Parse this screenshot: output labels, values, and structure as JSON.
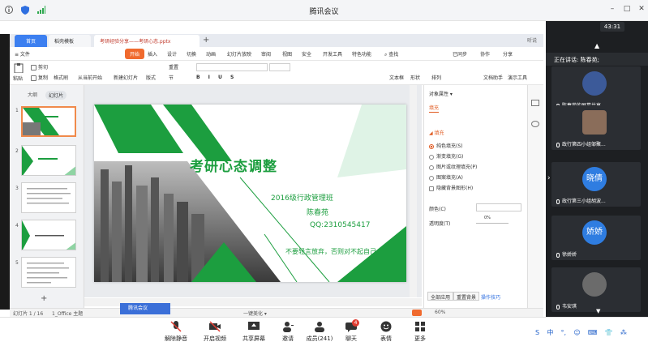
{
  "meeting": {
    "title": "腾讯会议",
    "timer": "43:31",
    "speaking_label": "正在讲话: 陈春苑;",
    "meeting_label": "腾讯会议",
    "window_buttons": [
      "–",
      "□",
      "✕"
    ]
  },
  "wps": {
    "tabs": [
      {
        "label": "首页"
      },
      {
        "label": "稻壳模板"
      },
      {
        "label": "考研经验分享——考研心态.pptx"
      }
    ],
    "tab_add": "+",
    "tab_right": "听说",
    "menu": {
      "file": "≡ 文件",
      "start": "开始",
      "items": [
        "插入",
        "设计",
        "切换",
        "动画",
        "幻灯片放映",
        "审阅",
        "视图",
        "安全",
        "开发工具",
        "特色功能"
      ],
      "search": "查找",
      "sync": "已同步",
      "collab": "协作",
      "share": "分享"
    },
    "toolbar": {
      "paste": "粘贴",
      "cut": "剪切",
      "copy": "复制",
      "format_painter": "格式刷",
      "from_current": "从当前开始",
      "new_slide": "新建幻灯片",
      "layout": "版式",
      "section": "节",
      "reset": "重置",
      "text_box": "文本框",
      "shape": "形状",
      "arrange": "排列",
      "doc_helper": "文档助手",
      "presentation_tool": "演示工具"
    },
    "left_panel": {
      "tab_outline": "大纲",
      "tab_slides": "幻灯片",
      "slide_numbers": [
        "1",
        "2",
        "3",
        "4",
        "5"
      ],
      "add": "+"
    },
    "slide": {
      "title": "考研心态调整",
      "line1": "2016级行政管理班",
      "line2": "陈春苑",
      "line3": "QQ:2310545417",
      "motto": "不要轻言放弃，否则对不起自己。"
    },
    "properties": {
      "title": "对象属性 ▾",
      "tab": "填充",
      "section": "◢ 填充",
      "options": [
        "纯色填充(S)",
        "渐变填充(G)",
        "图片或纹理填充(P)",
        "图案填充(A)",
        "隐藏背景图形(H)"
      ],
      "color_label": "颜色(C)",
      "transparency_label": "透明度(T)",
      "transparency_value": "0%",
      "apply_all": "全部应用",
      "reset_bg": "重置背景",
      "tips": "操作技巧"
    },
    "status": {
      "slide_info": "幻灯片 1 / 16",
      "theme": "1_Office 主题",
      "beautify": "一键美化 ▾",
      "zoom": "60%"
    }
  },
  "participants": [
    {
      "name": "陈春苑的屏幕共享",
      "avatar": "",
      "color": "#3c5a99"
    },
    {
      "name": "政行第四小组邹聚...",
      "avatar": "",
      "color": "#8a6d5a"
    },
    {
      "name": "政行第三小组胡波...",
      "avatar": "晓倩",
      "color": "#2f7de1"
    },
    {
      "name": "徐娇娇",
      "avatar": "娇娇",
      "color": "#2f7de1"
    },
    {
      "name": "韦安琪",
      "avatar": "",
      "color": "#6b6b6b"
    }
  ],
  "bottom_bar": {
    "buttons": [
      {
        "label": "解除静音",
        "icon": "mic-off-icon"
      },
      {
        "label": "开启视频",
        "icon": "video-off-icon"
      },
      {
        "label": "共享屏幕",
        "icon": "screen-share-icon"
      },
      {
        "label": "邀请",
        "icon": "invite-icon"
      },
      {
        "label": "成员(241)",
        "icon": "members-icon"
      },
      {
        "label": "聊天",
        "icon": "chat-icon"
      },
      {
        "label": "表情",
        "icon": "emoji-icon"
      },
      {
        "label": "更多",
        "icon": "more-icon"
      }
    ],
    "chat_badge": "4",
    "tray": [
      "S",
      "中",
      "°,",
      "☺",
      "⌨",
      "👕",
      "⁂"
    ]
  },
  "colors": {
    "accent_green": "#1c9e3f",
    "wps_orange": "#f06a2e",
    "meeting_blue": "#3b6fd8"
  }
}
